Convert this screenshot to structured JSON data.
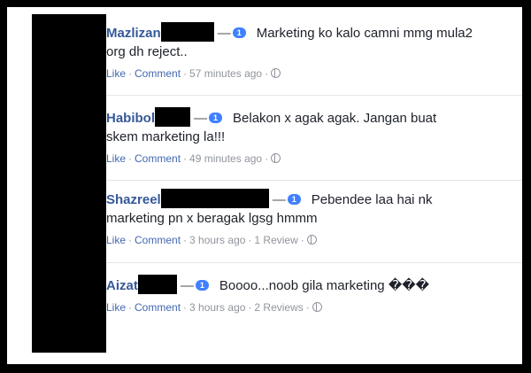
{
  "comments": [
    {
      "name": "Mazlizan",
      "badge": "1",
      "text_line1": "Marketing ko kalo camni mmg mula2",
      "text_line2": "org dh reject..",
      "like": "Like",
      "comment": "Comment",
      "time": "57 minutes ago",
      "reviews": ""
    },
    {
      "name": "Habibol",
      "badge": "1",
      "text_line1": "Belakon x agak agak. Jangan buat",
      "text_line2": "skem marketing la!!!",
      "like": "Like",
      "comment": "Comment",
      "time": "49 minutes ago",
      "reviews": ""
    },
    {
      "name": "Shazreel",
      "badge": "1",
      "text_line1": "Pebendee laa hai nk",
      "text_line2": "marketing pn x beragak lgsg hmmm",
      "like": "Like",
      "comment": "Comment",
      "time": "3 hours ago",
      "reviews": "1 Review"
    },
    {
      "name": "Aizat",
      "badge": "1",
      "text_line1": "Boooo...noob gila marketing ���",
      "like": "Like",
      "comment": "Comment",
      "time": "3 hours ago",
      "reviews": "2 Reviews"
    }
  ],
  "separator": "·",
  "dash": "—",
  "colors": {
    "name": "#365899",
    "link": "#4267b2",
    "badge": "#4080ff",
    "muted": "#90949c"
  },
  "icons": [
    "globe-icon",
    "redaction-box"
  ]
}
